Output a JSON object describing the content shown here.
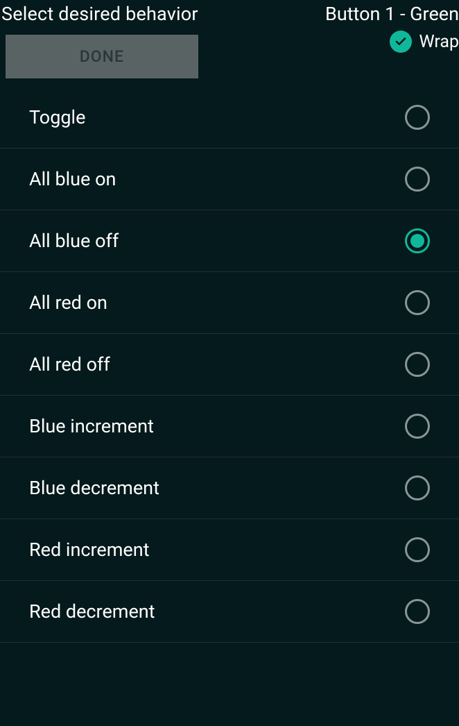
{
  "header": {
    "title": "Select desired behavior",
    "subtitle": "Button 1 - Green",
    "done_label": "DONE",
    "wrap_label": "Wrap",
    "wrap_checked": true
  },
  "options": [
    {
      "label": "Toggle",
      "selected": false
    },
    {
      "label": "All blue on",
      "selected": false
    },
    {
      "label": "All blue off",
      "selected": true
    },
    {
      "label": "All red on",
      "selected": false
    },
    {
      "label": "All red off",
      "selected": false
    },
    {
      "label": "Blue increment",
      "selected": false
    },
    {
      "label": "Blue decrement",
      "selected": false
    },
    {
      "label": "Red increment",
      "selected": false
    },
    {
      "label": "Red decrement",
      "selected": false
    }
  ],
  "colors": {
    "accent": "#0fb89b",
    "background": "#051a1c"
  }
}
